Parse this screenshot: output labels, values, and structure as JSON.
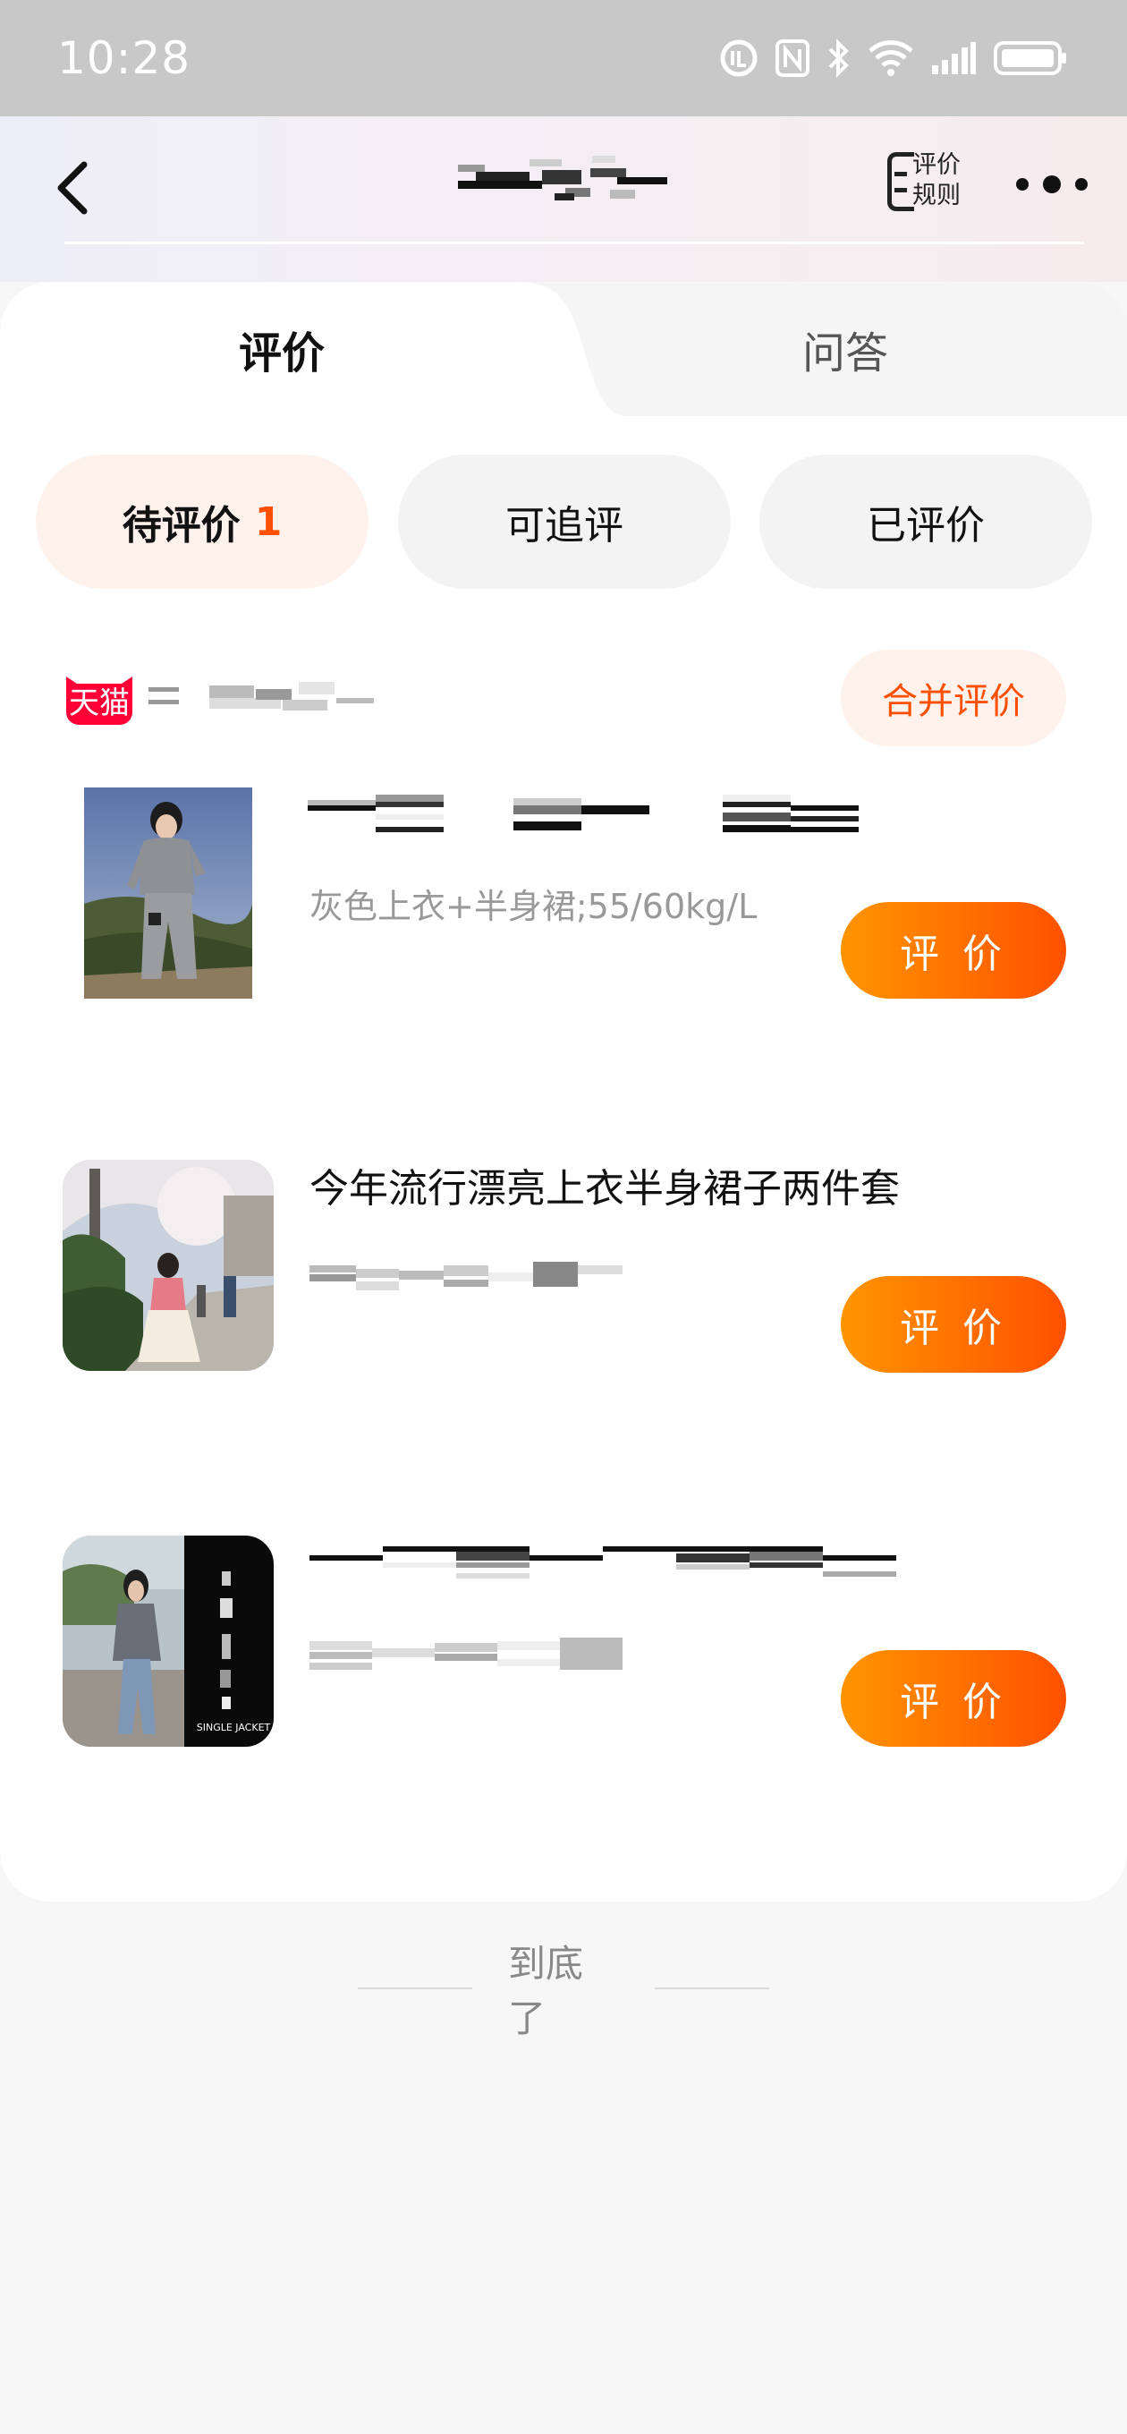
{
  "status_bar": {
    "time": "10:28"
  },
  "header": {
    "title": "",
    "rules_label_line1": "评价",
    "rules_label_line2": "规则"
  },
  "tabs": [
    {
      "label": "评价"
    },
    {
      "label": "问答"
    }
  ],
  "filters": [
    {
      "label": "待评价",
      "count": "1",
      "active": true
    },
    {
      "label": "可追评"
    },
    {
      "label": "已评价"
    }
  ],
  "shop": {
    "logo_text": "天猫",
    "merge_label": "合并评价"
  },
  "products": [
    {
      "title": "",
      "spec": "灰色上衣+半身裙;55/60kg/L",
      "action_label": "评 价"
    },
    {
      "title": "今年流行漂亮上衣半身裙子两件套",
      "spec": "",
      "action_label": "评 价"
    },
    {
      "title": "",
      "spec": "",
      "image_text": "SINGLE JACKET",
      "action_label": "评 价"
    }
  ],
  "footer": {
    "end_text": "到底了"
  },
  "colors": {
    "accent": "#ff5000",
    "button_gradient_start": "#ff9500",
    "tmall_red": "#ff0036"
  }
}
